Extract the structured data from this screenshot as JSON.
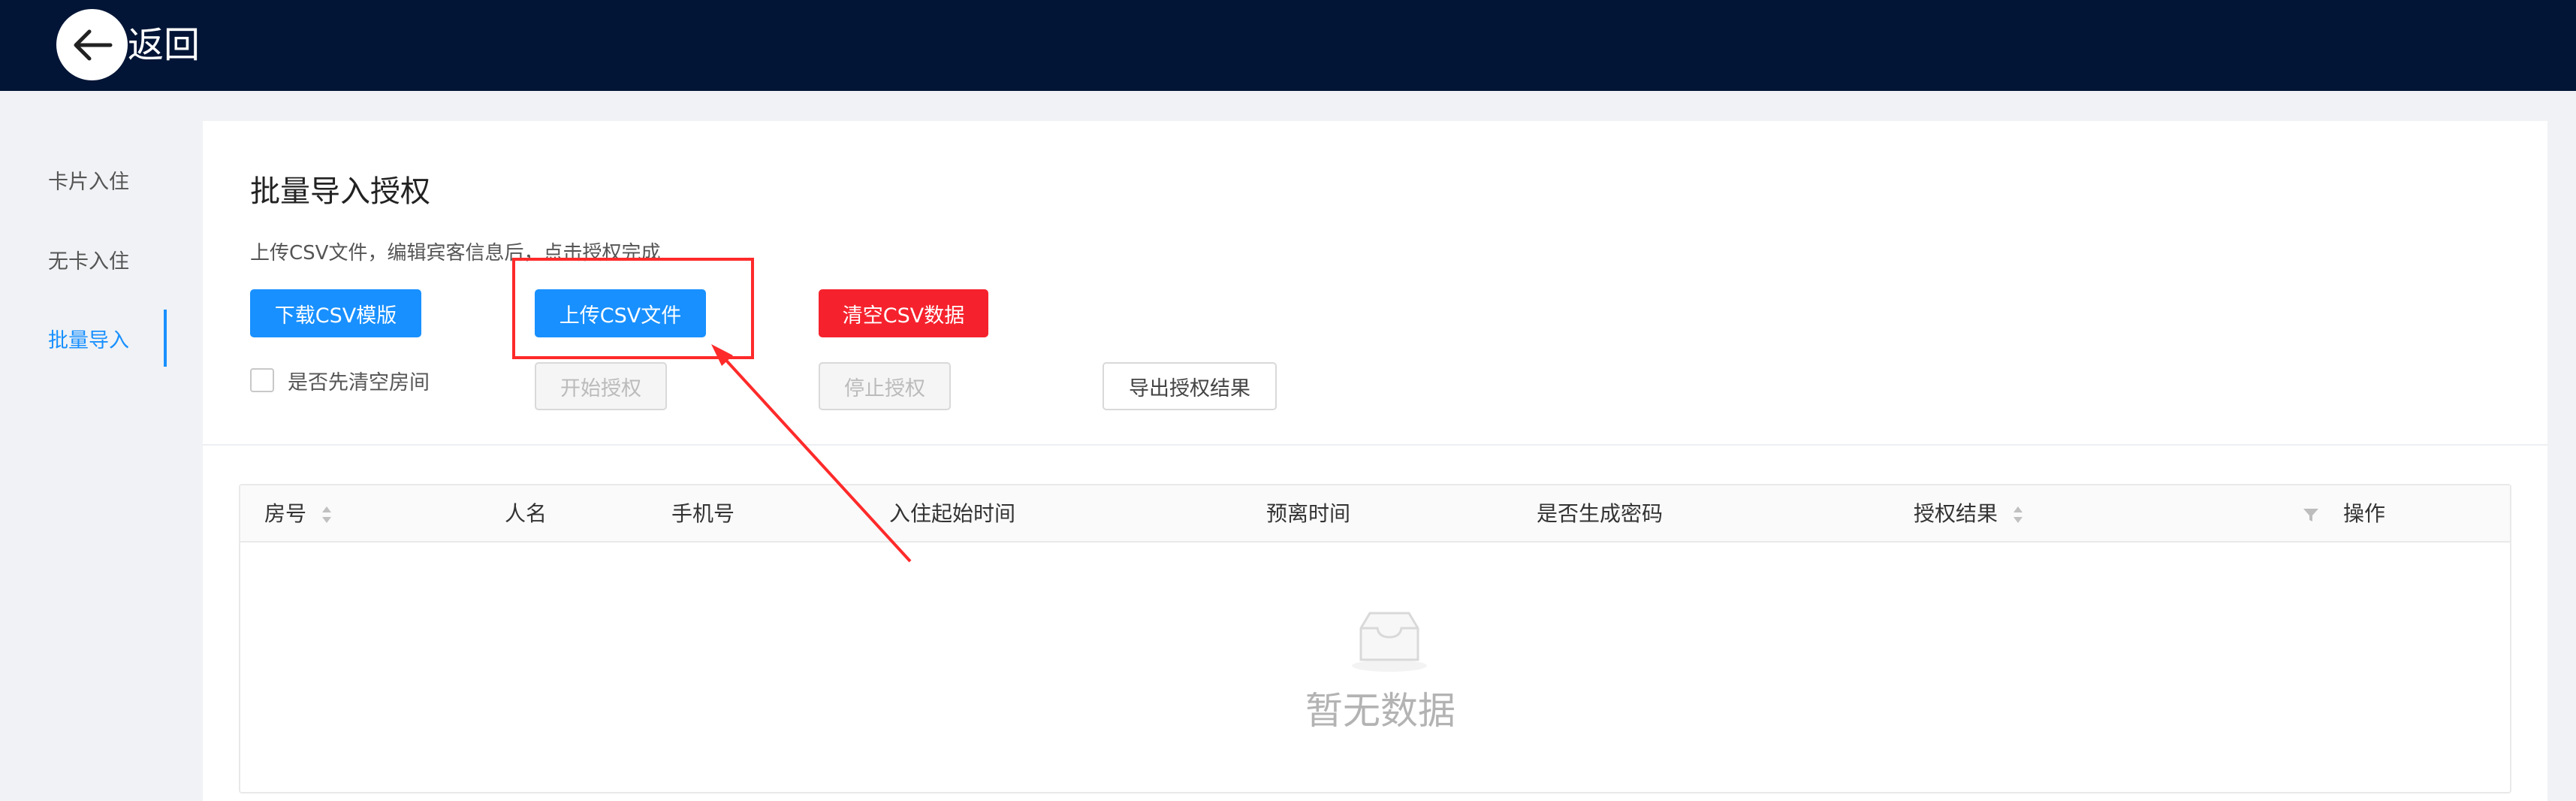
{
  "header": {
    "back_label": "返回"
  },
  "sidebar": {
    "items": [
      {
        "label": "卡片入住"
      },
      {
        "label": "无卡入住"
      },
      {
        "label": "批量导入"
      }
    ]
  },
  "page": {
    "title": "批量导入授权",
    "hint": "上传CSV文件，编辑宾客信息后，点击授权完成"
  },
  "buttons": {
    "download_template": "下载CSV模版",
    "upload_csv": "上传CSV文件",
    "clear_csv": "清空CSV数据",
    "start_auth": "开始授权",
    "stop_auth": "停止授权",
    "export_results": "导出授权结果"
  },
  "checkbox": {
    "clear_rooms_label": "是否先清空房间"
  },
  "table": {
    "columns": [
      "房号",
      "人名",
      "手机号",
      "入住起始时间",
      "预离时间",
      "是否生成密码",
      "授权结果",
      "操作"
    ],
    "empty_text": "暂无数据"
  },
  "colors": {
    "header_bg": "#021536",
    "primary": "#1890ff",
    "danger": "#f5222d",
    "annotation": "#ff2a2a"
  }
}
